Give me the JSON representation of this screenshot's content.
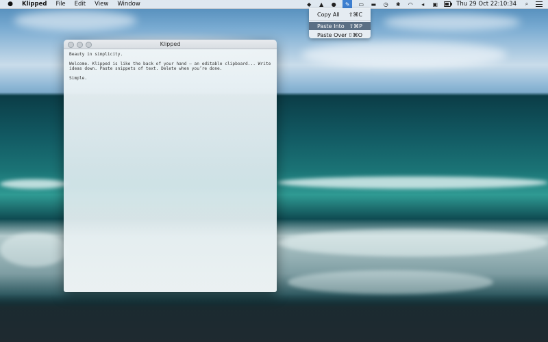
{
  "menubar": {
    "app_name": "Klipped",
    "menus": [
      "File",
      "Edit",
      "View",
      "Window"
    ],
    "clock": "Thu 29 Oct  22:10:34",
    "status_icons": [
      "dropbox-icon",
      "google-drive-icon",
      "app-status-icon",
      "klipped-icon",
      "airplay-icon",
      "display-icon",
      "time-machine-icon",
      "bluetooth-icon",
      "wifi-icon",
      "volume-icon",
      "keyboard-icon",
      "battery-icon",
      "spotlight-icon",
      "notification-center-icon"
    ]
  },
  "dropdown": {
    "items": [
      {
        "label": "Copy All",
        "shortcut": "⇧⌘C"
      },
      {
        "label": "Paste Into",
        "shortcut": "⇧⌘P"
      },
      {
        "label": "Paste Over",
        "shortcut": "⇧⌘O"
      }
    ],
    "selected": "Paste Into"
  },
  "window": {
    "title": "Klipped",
    "lines": [
      "Beauty in simplicity.",
      "Welcome. Klipped is like the back of your hand – an editable clipboard... Write ideas down. Paste snippets of text. Delete when you’re done.",
      "Simple."
    ]
  }
}
